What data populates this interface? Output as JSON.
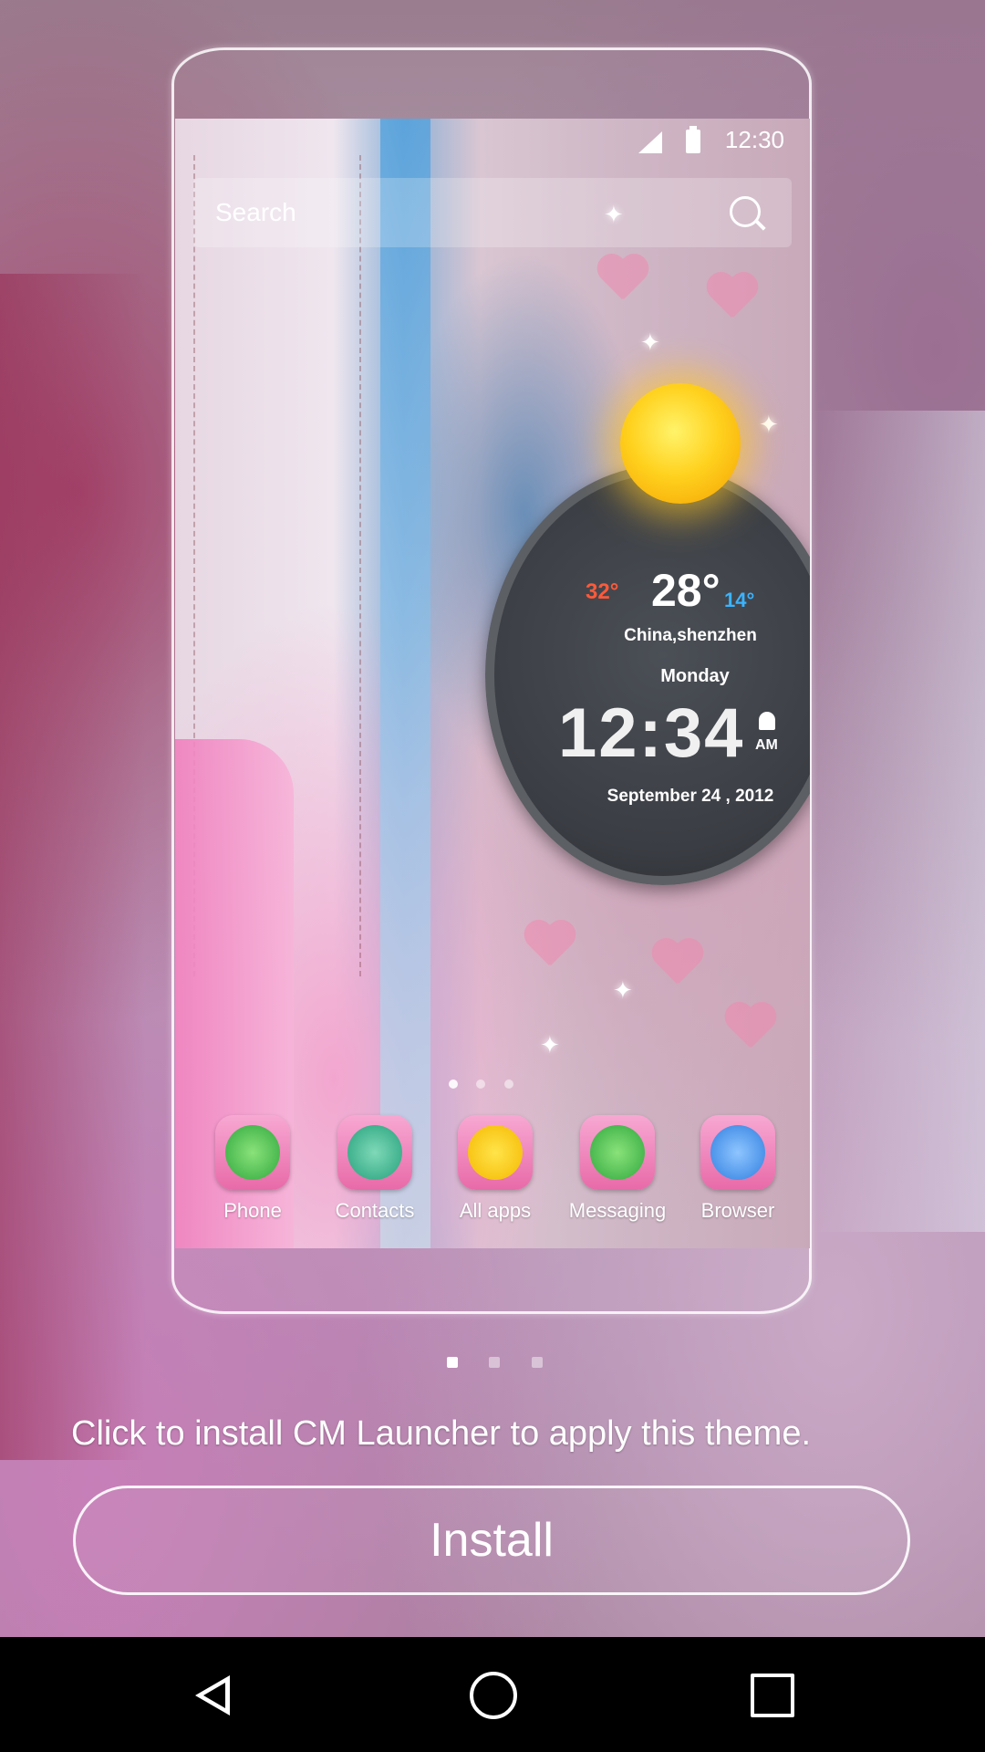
{
  "status_bar": {
    "time": "12:30"
  },
  "search": {
    "placeholder": "Search"
  },
  "weather": {
    "temp_high": "32°",
    "temp_current": "28°",
    "temp_low": "14°",
    "city": "China,shenzhen",
    "weekday": "Monday",
    "time": "12:34",
    "ampm": "AM",
    "date": "September 24 , 2012"
  },
  "dock": {
    "items": [
      {
        "label": "Phone",
        "icon": "phone-icon"
      },
      {
        "label": "Contacts",
        "icon": "contacts-icon"
      },
      {
        "label": "All apps",
        "icon": "all-apps-icon"
      },
      {
        "label": "Messaging",
        "icon": "messaging-icon"
      },
      {
        "label": "Browser",
        "icon": "browser-icon"
      }
    ]
  },
  "pager": {
    "pages": 3,
    "active": 1
  },
  "install_hint": "Click to install CM Launcher to apply this theme.",
  "install_button": "Install",
  "colors": {
    "accent": "#ffffff",
    "temp_high": "#ff5a3a",
    "temp_low": "#3ab4ff"
  }
}
